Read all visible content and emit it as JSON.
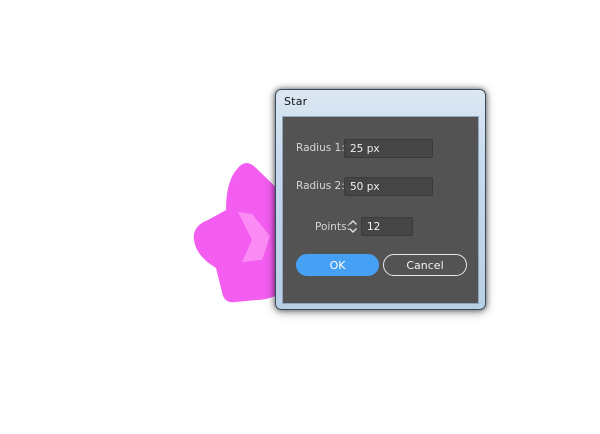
{
  "dialog": {
    "title": "Star"
  },
  "fields": {
    "radius1": {
      "label": "Radius 1:",
      "value": "25 px"
    },
    "radius2": {
      "label": "Radius 2:",
      "value": "50 px"
    },
    "points": {
      "label": "Points:",
      "value": "12"
    }
  },
  "buttons": {
    "ok": "OK",
    "cancel": "Cancel"
  },
  "colors": {
    "star_fill": "#f35df0",
    "star_highlight": "#ff9cf7",
    "panel_bg": "#535353",
    "ok_button": "#46a0f4"
  },
  "icons": {
    "stepper": "up-down-chevron-icon"
  }
}
